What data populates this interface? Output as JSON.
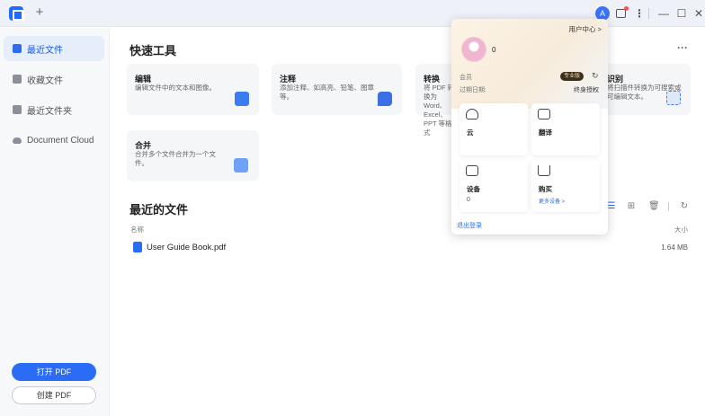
{
  "titlebar": {
    "add_tab": "+",
    "avatar_letter": "A",
    "more": "⋮",
    "minimize": "—",
    "maximize": "☐",
    "close": "✕"
  },
  "sidebar": {
    "items": [
      {
        "label": "最近文件",
        "active": true
      },
      {
        "label": "收藏文件",
        "active": false
      },
      {
        "label": "最近文件夹",
        "active": false
      },
      {
        "label": "Document Cloud",
        "active": false
      }
    ],
    "open_pdf": "打开 PDF",
    "create_pdf": "创建 PDF"
  },
  "main": {
    "tools_title": "快速工具",
    "more": "···",
    "tools": [
      {
        "title": "编辑",
        "desc": "编辑文件中的文本和图像。"
      },
      {
        "title": "注释",
        "desc": "添加注释、如高亮、铅笔、图章等。"
      },
      {
        "title": "转换",
        "desc": "将 PDF 转换为 Word、Excel、PPT 等格式"
      },
      {
        "title": "识别",
        "desc": "将扫描件转换为可搜索或可编辑文本。"
      },
      {
        "title": "合并",
        "desc": "合并多个文件合并为一个文件。"
      }
    ],
    "recent_title": "最近的文件",
    "columns": {
      "name": "名称",
      "size": "大小"
    },
    "files": [
      {
        "name": "User Guide Book.pdf",
        "size": "1.64 MB"
      }
    ],
    "view_icons": {
      "list": "☰",
      "grid": "⊞",
      "delete": "🗑",
      "refresh": "↻"
    }
  },
  "popup": {
    "user_center": "用户中心 >",
    "username": "0",
    "member_label": "会员",
    "badge": "专业版",
    "sync_icon": "↻",
    "expiry_label": "过期日期:",
    "expiry_value": "终身授权",
    "tiles": [
      {
        "label": "云",
        "sub": ""
      },
      {
        "label": "翻译",
        "sub": ""
      },
      {
        "label": "设备",
        "sub": "0"
      },
      {
        "label": "购买",
        "sub": "更多设备 >"
      }
    ],
    "logout": "退出登录"
  },
  "colors": {
    "accent": "#2a6cf6",
    "sidebar_active_bg": "#e6eefc",
    "card_bg": "#f5f6f8",
    "badge_bg": "#3d2f1e"
  }
}
